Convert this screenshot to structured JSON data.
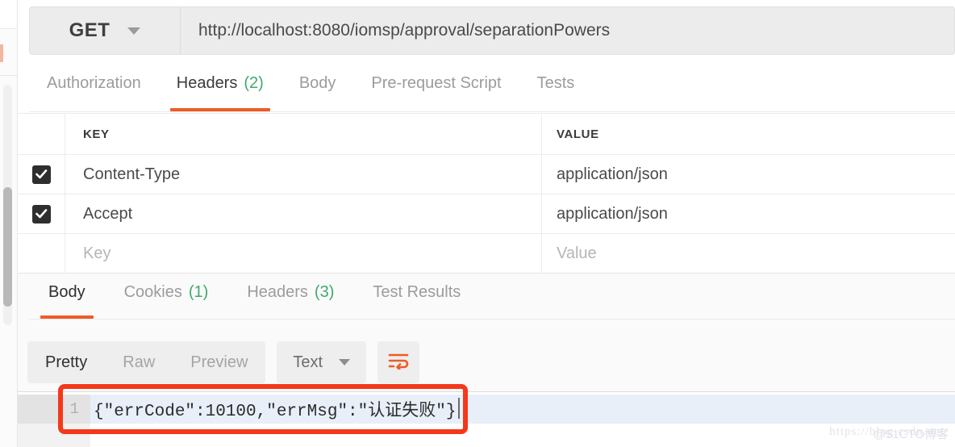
{
  "request": {
    "method": "GET",
    "url": "http://localhost:8080/iomsp/approval/separationPowers",
    "tabs": [
      {
        "label": "Authorization",
        "count": "",
        "active": false,
        "dim": true
      },
      {
        "label": "Headers",
        "count": "(2)",
        "active": true,
        "dim": false
      },
      {
        "label": "Body",
        "count": "",
        "active": false,
        "dim": true
      },
      {
        "label": "Pre-request Script",
        "count": "",
        "active": false,
        "dim": true
      },
      {
        "label": "Tests",
        "count": "",
        "active": false,
        "dim": true
      }
    ],
    "headers_table": {
      "columns": [
        "KEY",
        "VALUE"
      ],
      "rows": [
        {
          "checked": true,
          "key": "Content-Type",
          "value": "application/json"
        },
        {
          "checked": true,
          "key": "Accept",
          "value": "application/json"
        },
        {
          "checked": false,
          "key": "Key",
          "value": "Value",
          "is_placeholder": true
        }
      ]
    }
  },
  "response": {
    "tabs": [
      {
        "label": "Body",
        "count": "",
        "active": true
      },
      {
        "label": "Cookies",
        "count": "(1)",
        "active": false
      },
      {
        "label": "Headers",
        "count": "(3)",
        "active": false
      },
      {
        "label": "Test Results",
        "count": "",
        "active": false
      }
    ],
    "view_modes": [
      {
        "label": "Pretty",
        "active": true
      },
      {
        "label": "Raw",
        "active": false
      },
      {
        "label": "Preview",
        "active": false
      }
    ],
    "format": "Text",
    "wrap_icon": "wrap-lines-icon",
    "body": {
      "line_number": "1",
      "content": "{\"errCode\":10100,\"errMsg\":\"认证失败\"}"
    }
  },
  "colors": {
    "accent": "#ef5b25",
    "count_green": "#3dab6c",
    "annotation_red": "#f4381a",
    "line_highlight": "#e8eff9"
  },
  "watermark": {
    "url": "https://blog.csdn.net/",
    "site": "@51CTO博客"
  }
}
